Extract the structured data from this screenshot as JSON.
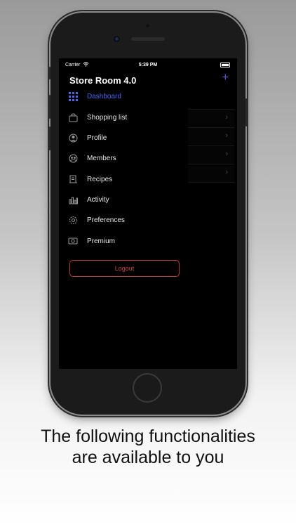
{
  "status_bar": {
    "carrier": "Carrier",
    "time": "5:39 PM"
  },
  "header": {
    "title": "Store Room 4.0",
    "add_label": "+"
  },
  "menu": {
    "items": [
      {
        "label": "Dashboard",
        "icon": "grid-icon",
        "active": true
      },
      {
        "label": "Shopping list",
        "icon": "bag-icon"
      },
      {
        "label": "Profile",
        "icon": "person-circle-icon"
      },
      {
        "label": "Members",
        "icon": "members-icon"
      },
      {
        "label": "Recipes",
        "icon": "receipt-icon"
      },
      {
        "label": "Activity",
        "icon": "bar-chart-icon"
      },
      {
        "label": "Preferences",
        "icon": "gear-icon"
      },
      {
        "label": "Premium",
        "icon": "money-icon"
      }
    ]
  },
  "logout": {
    "label": "Logout"
  },
  "background_rows": {
    "chevron": "›"
  },
  "caption": {
    "line1": "The following functionalities",
    "line2": "are available to you"
  },
  "colors": {
    "accent": "#4a63f0",
    "logout": "#c4313c",
    "screen_bg": "#000000"
  }
}
